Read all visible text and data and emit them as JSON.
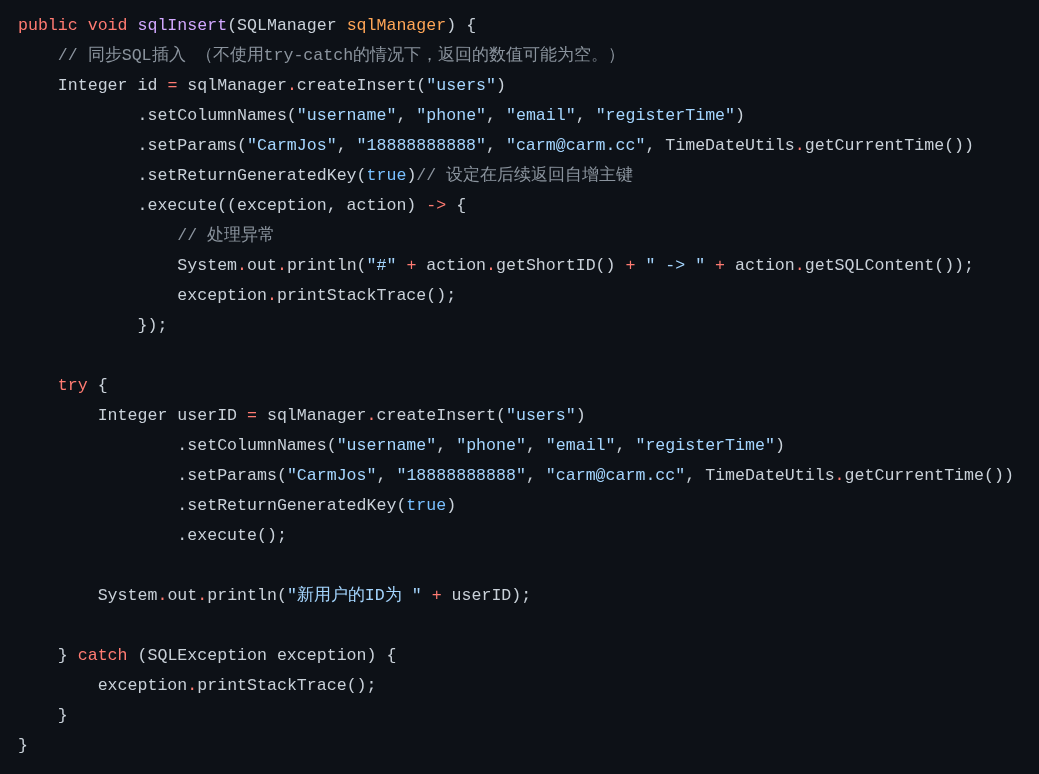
{
  "code_block": {
    "lines": [
      {
        "kind": "code",
        "tokens": [
          {
            "kind": "keyword",
            "text": "public void "
          },
          {
            "kind": "function",
            "text": "sqlInsert"
          },
          {
            "kind": "plain",
            "text": "(SQLManager "
          },
          {
            "kind": "param",
            "text": "sqlManager"
          },
          {
            "kind": "plain",
            "text": ") {"
          }
        ]
      },
      {
        "kind": "code",
        "tokens": [
          {
            "kind": "comment",
            "text": "    // 同步SQL插入 （不使用try-catch的情况下，返回的数值可能为空。）"
          }
        ]
      },
      {
        "kind": "code",
        "tokens": [
          {
            "kind": "plain",
            "text": "    Integer id "
          },
          {
            "kind": "operator",
            "text": "="
          },
          {
            "kind": "plain",
            "text": " sqlManager"
          },
          {
            "kind": "operator",
            "text": "."
          },
          {
            "kind": "plain",
            "text": "createInsert("
          },
          {
            "kind": "string",
            "text": "\"users\""
          },
          {
            "kind": "plain",
            "text": ")"
          }
        ]
      },
      {
        "kind": "code",
        "tokens": [
          {
            "kind": "plain",
            "text": "            .setColumnNames("
          },
          {
            "kind": "string",
            "text": "\"username\""
          },
          {
            "kind": "plain",
            "text": ", "
          },
          {
            "kind": "string",
            "text": "\"phone\""
          },
          {
            "kind": "plain",
            "text": ", "
          },
          {
            "kind": "string",
            "text": "\"email\""
          },
          {
            "kind": "plain",
            "text": ", "
          },
          {
            "kind": "string",
            "text": "\"registerTime\""
          },
          {
            "kind": "plain",
            "text": ")"
          }
        ]
      },
      {
        "kind": "code",
        "tokens": [
          {
            "kind": "plain",
            "text": "            .setParams("
          },
          {
            "kind": "string",
            "text": "\"CarmJos\""
          },
          {
            "kind": "plain",
            "text": ", "
          },
          {
            "kind": "string",
            "text": "\"18888888888\""
          },
          {
            "kind": "plain",
            "text": ", "
          },
          {
            "kind": "string",
            "text": "\"carm@carm.cc\""
          },
          {
            "kind": "plain",
            "text": ", TimeDateUtils"
          },
          {
            "kind": "operator",
            "text": "."
          },
          {
            "kind": "plain",
            "text": "getCurrentTime())"
          }
        ]
      },
      {
        "kind": "code",
        "tokens": [
          {
            "kind": "plain",
            "text": "            .setReturnGeneratedKey("
          },
          {
            "kind": "literal",
            "text": "true"
          },
          {
            "kind": "plain",
            "text": ")"
          },
          {
            "kind": "comment",
            "text": "// 设定在后续返回自增主键"
          }
        ]
      },
      {
        "kind": "code",
        "tokens": [
          {
            "kind": "plain",
            "text": "            .execute((exception, action) "
          },
          {
            "kind": "operator",
            "text": "->"
          },
          {
            "kind": "plain",
            "text": " {"
          }
        ]
      },
      {
        "kind": "code",
        "tokens": [
          {
            "kind": "comment",
            "text": "                // 处理异常"
          }
        ]
      },
      {
        "kind": "code",
        "tokens": [
          {
            "kind": "plain",
            "text": "                System"
          },
          {
            "kind": "operator",
            "text": "."
          },
          {
            "kind": "plain",
            "text": "out"
          },
          {
            "kind": "operator",
            "text": "."
          },
          {
            "kind": "plain",
            "text": "println("
          },
          {
            "kind": "string",
            "text": "\"#\""
          },
          {
            "kind": "operator",
            "text": " + "
          },
          {
            "kind": "plain",
            "text": "action"
          },
          {
            "kind": "operator",
            "text": "."
          },
          {
            "kind": "plain",
            "text": "getShortID() "
          },
          {
            "kind": "operator",
            "text": "+ "
          },
          {
            "kind": "string",
            "text": "\" -> \""
          },
          {
            "kind": "operator",
            "text": " + "
          },
          {
            "kind": "plain",
            "text": "action"
          },
          {
            "kind": "operator",
            "text": "."
          },
          {
            "kind": "plain",
            "text": "getSQLContent());"
          }
        ]
      },
      {
        "kind": "code",
        "tokens": [
          {
            "kind": "plain",
            "text": "                exception"
          },
          {
            "kind": "operator",
            "text": "."
          },
          {
            "kind": "plain",
            "text": "printStackTrace();"
          }
        ]
      },
      {
        "kind": "code",
        "tokens": [
          {
            "kind": "plain",
            "text": "            });"
          }
        ]
      },
      {
        "kind": "blank"
      },
      {
        "kind": "code",
        "tokens": [
          {
            "kind": "keyword",
            "text": "    try"
          },
          {
            "kind": "plain",
            "text": " {"
          }
        ]
      },
      {
        "kind": "code",
        "tokens": [
          {
            "kind": "plain",
            "text": "        Integer userID "
          },
          {
            "kind": "operator",
            "text": "="
          },
          {
            "kind": "plain",
            "text": " sqlManager"
          },
          {
            "kind": "operator",
            "text": "."
          },
          {
            "kind": "plain",
            "text": "createInsert("
          },
          {
            "kind": "string",
            "text": "\"users\""
          },
          {
            "kind": "plain",
            "text": ")"
          }
        ]
      },
      {
        "kind": "code",
        "tokens": [
          {
            "kind": "plain",
            "text": "                .setColumnNames("
          },
          {
            "kind": "string",
            "text": "\"username\""
          },
          {
            "kind": "plain",
            "text": ", "
          },
          {
            "kind": "string",
            "text": "\"phone\""
          },
          {
            "kind": "plain",
            "text": ", "
          },
          {
            "kind": "string",
            "text": "\"email\""
          },
          {
            "kind": "plain",
            "text": ", "
          },
          {
            "kind": "string",
            "text": "\"registerTime\""
          },
          {
            "kind": "plain",
            "text": ")"
          }
        ]
      },
      {
        "kind": "code",
        "tokens": [
          {
            "kind": "plain",
            "text": "                .setParams("
          },
          {
            "kind": "string",
            "text": "\"CarmJos\""
          },
          {
            "kind": "plain",
            "text": ", "
          },
          {
            "kind": "string",
            "text": "\"18888888888\""
          },
          {
            "kind": "plain",
            "text": ", "
          },
          {
            "kind": "string",
            "text": "\"carm@carm.cc\""
          },
          {
            "kind": "plain",
            "text": ", TimeDateUtils"
          },
          {
            "kind": "operator",
            "text": "."
          },
          {
            "kind": "plain",
            "text": "getCurrentTime())"
          }
        ]
      },
      {
        "kind": "code",
        "tokens": [
          {
            "kind": "plain",
            "text": "                .setReturnGeneratedKey("
          },
          {
            "kind": "literal",
            "text": "true"
          },
          {
            "kind": "plain",
            "text": ")"
          }
        ]
      },
      {
        "kind": "code",
        "tokens": [
          {
            "kind": "plain",
            "text": "                .execute();"
          }
        ]
      },
      {
        "kind": "blank"
      },
      {
        "kind": "code",
        "tokens": [
          {
            "kind": "plain",
            "text": "        System"
          },
          {
            "kind": "operator",
            "text": "."
          },
          {
            "kind": "plain",
            "text": "out"
          },
          {
            "kind": "operator",
            "text": "."
          },
          {
            "kind": "plain",
            "text": "println("
          },
          {
            "kind": "string",
            "text": "\"新用户的ID为 \""
          },
          {
            "kind": "operator",
            "text": " + "
          },
          {
            "kind": "plain",
            "text": "userID);"
          }
        ]
      },
      {
        "kind": "blank"
      },
      {
        "kind": "code",
        "tokens": [
          {
            "kind": "plain",
            "text": "    } "
          },
          {
            "kind": "keyword",
            "text": "catch"
          },
          {
            "kind": "plain",
            "text": " (SQLException exception) {"
          }
        ]
      },
      {
        "kind": "code",
        "tokens": [
          {
            "kind": "plain",
            "text": "        exception"
          },
          {
            "kind": "operator",
            "text": "."
          },
          {
            "kind": "plain",
            "text": "printStackTrace();"
          }
        ]
      },
      {
        "kind": "code",
        "tokens": [
          {
            "kind": "plain",
            "text": "    }"
          }
        ]
      },
      {
        "kind": "code",
        "tokens": [
          {
            "kind": "plain",
            "text": "}"
          }
        ]
      }
    ]
  }
}
